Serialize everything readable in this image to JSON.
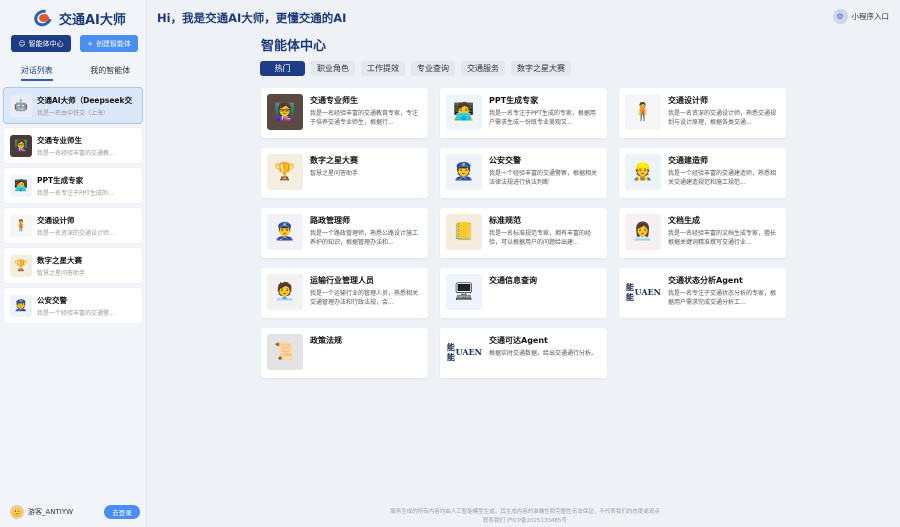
{
  "app": {
    "title": "交通AI大师"
  },
  "sidebar": {
    "btn_center_label": "智能体中心",
    "btn_create_label": "创建智能体",
    "tabs": [
      {
        "label": "对话列表"
      },
      {
        "label": "我的智能体"
      }
    ],
    "chats": [
      {
        "name": "交通AI大师（Deepseek交",
        "desc": "我是一名由中铁交（上海）",
        "icon": "robot-icon"
      },
      {
        "name": "交通专业师生",
        "desc": "我是一名经验丰富的交通教...",
        "icon": "teacher-icon"
      },
      {
        "name": "PPT生成专家",
        "desc": "我是一名专注于PPT生成的...",
        "icon": "presenter-icon"
      },
      {
        "name": "交通设计师",
        "desc": "我是一名资深的交通设计师...",
        "icon": "designer-icon"
      },
      {
        "name": "数字之星大赛",
        "desc": "智慧之星问答助手",
        "icon": "trophy-icon"
      },
      {
        "name": "公安交警",
        "desc": "我是一个经验丰富的交通警...",
        "icon": "police-icon"
      }
    ],
    "user_name": "游客_ANTIYW",
    "login_label": "去登录"
  },
  "header": {
    "greeting": "Hi，我是交通AI大师，更懂交通的AI",
    "mini_entry_label": "小程序入口"
  },
  "main": {
    "title": "智能体中心",
    "categories": [
      {
        "label": "热门"
      },
      {
        "label": "职业角色"
      },
      {
        "label": "工作提效"
      },
      {
        "label": "专业查询"
      },
      {
        "label": "交通服务"
      },
      {
        "label": "数字之星大赛"
      }
    ],
    "cards": [
      {
        "title": "交通专业师生",
        "desc": "我是一名经验丰富的交通教育专家，专注于培养交通专业师生，根据行...",
        "icon": "teacher-icon"
      },
      {
        "title": "PPT生成专家",
        "desc": "我是一名专注于PPT生成的专家，根据用户需求生成一份既专业美观又...",
        "icon": "presenter-icon"
      },
      {
        "title": "交通设计师",
        "desc": "我是一名资深的交通设计师，熟悉交通规划与设计原理，根据各类交通...",
        "icon": "designer-icon"
      },
      {
        "title": "数字之星大赛",
        "desc": "智慧之星问答助手",
        "icon": "trophy-icon"
      },
      {
        "title": "公安交警",
        "desc": "我是一个经验丰富的交通警察，根据相关法律法规进行执法判断",
        "icon": "police-icon"
      },
      {
        "title": "交通建造师",
        "desc": "我是一个经验丰富的交通建造师，熟悉相关交通建造规范和施工规范...",
        "icon": "builder-icon"
      },
      {
        "title": "路政管理师",
        "desc": "我是一个路政管理师，熟悉公路设计施工养护的知识，根据管理办法和...",
        "icon": "officer-icon"
      },
      {
        "title": "标准规范",
        "desc": "我是一名标准规范专家，拥有丰富的经验，可以根据用户的问题给出建...",
        "icon": "book-icon"
      },
      {
        "title": "文档生成",
        "desc": "我是一名经验丰富的文档生成专家，擅长根据关键词精准撰写交通行业...",
        "icon": "writer-icon"
      },
      {
        "title": "运输行业管理人员",
        "desc": "我是一个运输行业的管理人员，熟悉相关交通管理办法和行政法规，会...",
        "icon": "manager-icon"
      },
      {
        "title": "交通信息查询",
        "desc": "",
        "icon": "monitor-icon"
      },
      {
        "title": "交通状态分析Agent",
        "desc": "我是一名专注于交通状态分析的专家，根据用户需求完成交通分析工...",
        "icon": "wordmark-icon",
        "wordmark": [
          "能能",
          "UAEN"
        ]
      },
      {
        "title": "政策法规",
        "desc": "",
        "icon": "document-icon"
      },
      {
        "title": "交通可达Agent",
        "desc": "根据实时交通数据，给出交通通行分析。",
        "icon": "wordmark-icon",
        "wordmark": [
          "能能",
          "UAEN"
        ]
      }
    ]
  },
  "footer": {
    "line1": "服务生成的所有内容均由人工智能模型生成，其生成内容的准确性和完整性无法保证，不代表我们的态度或观点",
    "line2": "联系我们 沪ICP备2025133485号"
  }
}
